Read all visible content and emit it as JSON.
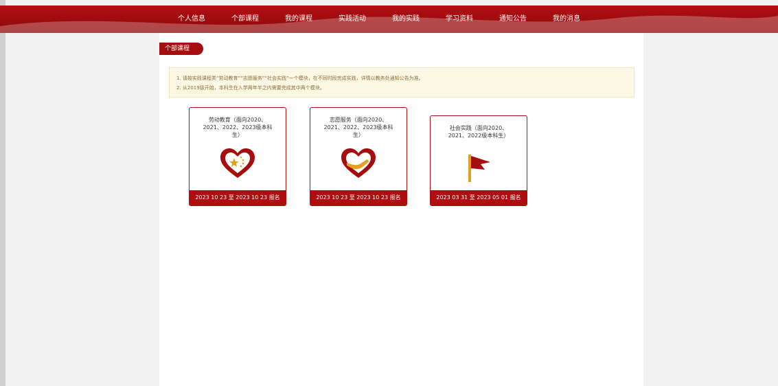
{
  "nav": [
    "个人信息",
    "个部课程",
    "我的课程",
    "实践活动",
    "我的实践",
    "学习资料",
    "通知公告",
    "我的消息"
  ],
  "tab_label": "个部课程",
  "notice": [
    "1. 请按实践课程类“劳动教育”“志愿服务”“社会实践”一个模块，在不同时段完成实践，详情以教务处通知公告为准。",
    "2. 从2019级开始，本科生在入学两年半之内需要完成其中两个模块。"
  ],
  "cards": [
    {
      "title": "劳动教育（面向2020、2021、2022、2023级本科生）",
      "date": "2023 10 23 至 2023 10 23 报名",
      "icon": "heart-star-icon"
    },
    {
      "title": "志愿服务（面向2020、2021、2022、2023级本科生）",
      "date": "2023 10 23 至 2023 10 23 报名",
      "icon": "heart-hand-icon"
    },
    {
      "title": "社会实践（面向2020、2021、2022级本科生）",
      "date": "2023 03 31 至 2023 05 01 报名",
      "icon": "flag-icon"
    }
  ],
  "colors": {
    "brand": "#a60d0f",
    "notice_bg": "#fcf8e3",
    "flag": "#e5a020"
  }
}
